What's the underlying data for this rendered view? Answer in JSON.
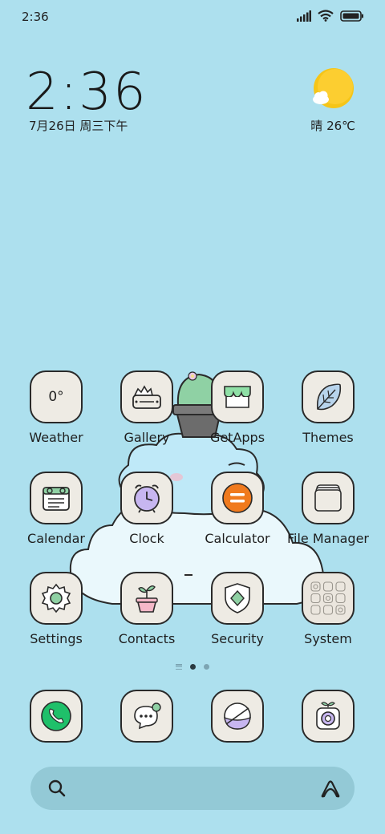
{
  "status_bar": {
    "time": "2:36"
  },
  "clock_widget": {
    "time": "2:36",
    "date": "7月26日 周三下午"
  },
  "weather_widget": {
    "text": "晴 26℃"
  },
  "apps": [
    {
      "label": "Weather",
      "icon": "weather-icon",
      "glyph": "0°"
    },
    {
      "label": "Gallery",
      "icon": "gallery-icon"
    },
    {
      "label": "GetApps",
      "icon": "getapps-icon"
    },
    {
      "label": "Themes",
      "icon": "themes-icon"
    },
    {
      "label": "Calendar",
      "icon": "calendar-icon"
    },
    {
      "label": "Clock",
      "icon": "clock-icon"
    },
    {
      "label": "Calculator",
      "icon": "calculator-icon"
    },
    {
      "label": "File Manager",
      "icon": "file-manager-icon"
    },
    {
      "label": "Settings",
      "icon": "settings-icon"
    },
    {
      "label": "Contacts",
      "icon": "contacts-icon"
    },
    {
      "label": "Security",
      "icon": "security-icon"
    },
    {
      "label": "System",
      "icon": "system-folder-icon"
    }
  ],
  "dock": [
    {
      "icon": "phone-icon"
    },
    {
      "icon": "messages-icon"
    },
    {
      "icon": "browser-icon"
    },
    {
      "icon": "camera-icon"
    }
  ],
  "page_indicator": {
    "pages": 2,
    "active": 1
  },
  "colors": {
    "background": "#ade0ee",
    "icon_bg": "#eeebe4",
    "search_bg": "#93c9d6",
    "sun": "#f5c518",
    "phone": "#1fc06a",
    "calculator": "#f07a1e"
  }
}
